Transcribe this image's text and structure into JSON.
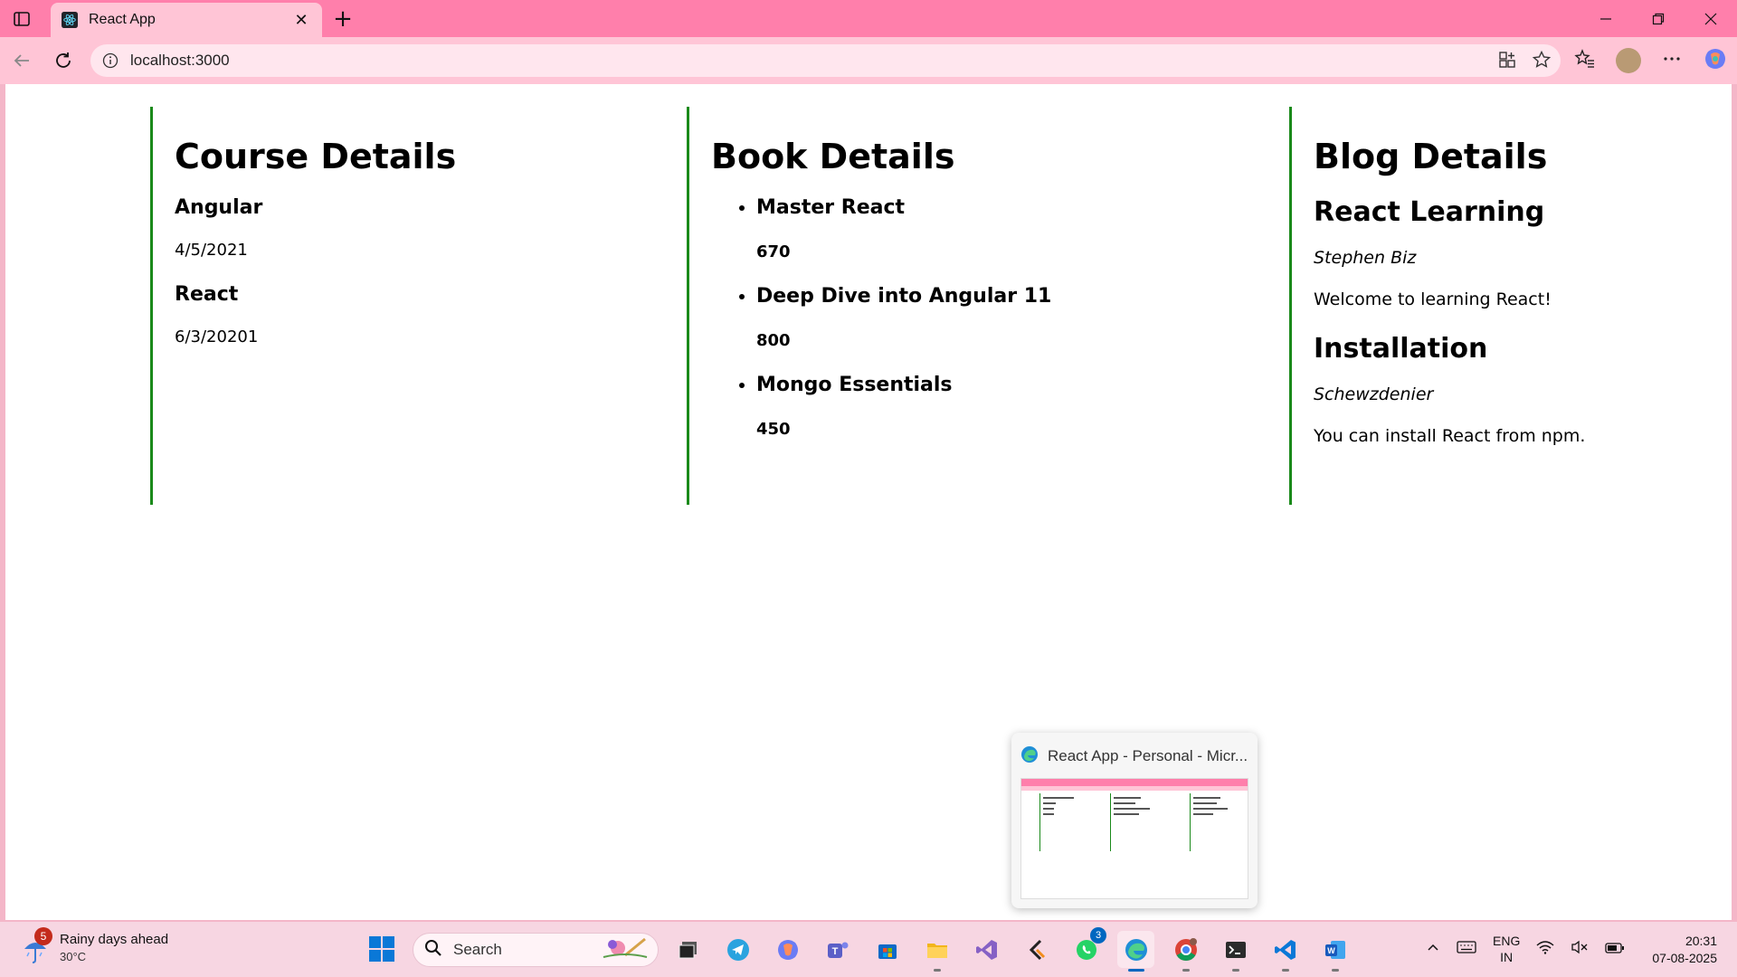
{
  "browser": {
    "tab_title": "React App",
    "url": "localhost:3000"
  },
  "course": {
    "heading": "Course Details",
    "items": [
      {
        "name": "Angular",
        "date": "4/5/2021"
      },
      {
        "name": "React",
        "date": "6/3/20201"
      }
    ]
  },
  "book": {
    "heading": "Book Details",
    "items": [
      {
        "name": "Master React",
        "price": "670"
      },
      {
        "name": "Deep Dive into Angular 11",
        "price": "800"
      },
      {
        "name": "Mongo Essentials",
        "price": "450"
      }
    ]
  },
  "blog": {
    "heading": "Blog Details",
    "items": [
      {
        "title": "React Learning",
        "author": "Stephen Biz",
        "content": "Welcome to learning React!"
      },
      {
        "title": "Installation",
        "author": "Schewzdenier",
        "content": "You can install React from npm."
      }
    ]
  },
  "preview": {
    "title": "React App - Personal - Micr..."
  },
  "taskbar": {
    "weather_badge": "5",
    "weather_title": "Rainy days ahead",
    "weather_temp": "30°C",
    "search_label": "Search",
    "whatsapp_badge": "3",
    "lang_line1": "ENG",
    "lang_line2": "IN",
    "time": "20:31",
    "date": "07-08-2025"
  },
  "colors": {
    "tabbar": "#ff7fab",
    "addressbar": "#ffc5d6",
    "column_border": "#1a8a1a"
  }
}
